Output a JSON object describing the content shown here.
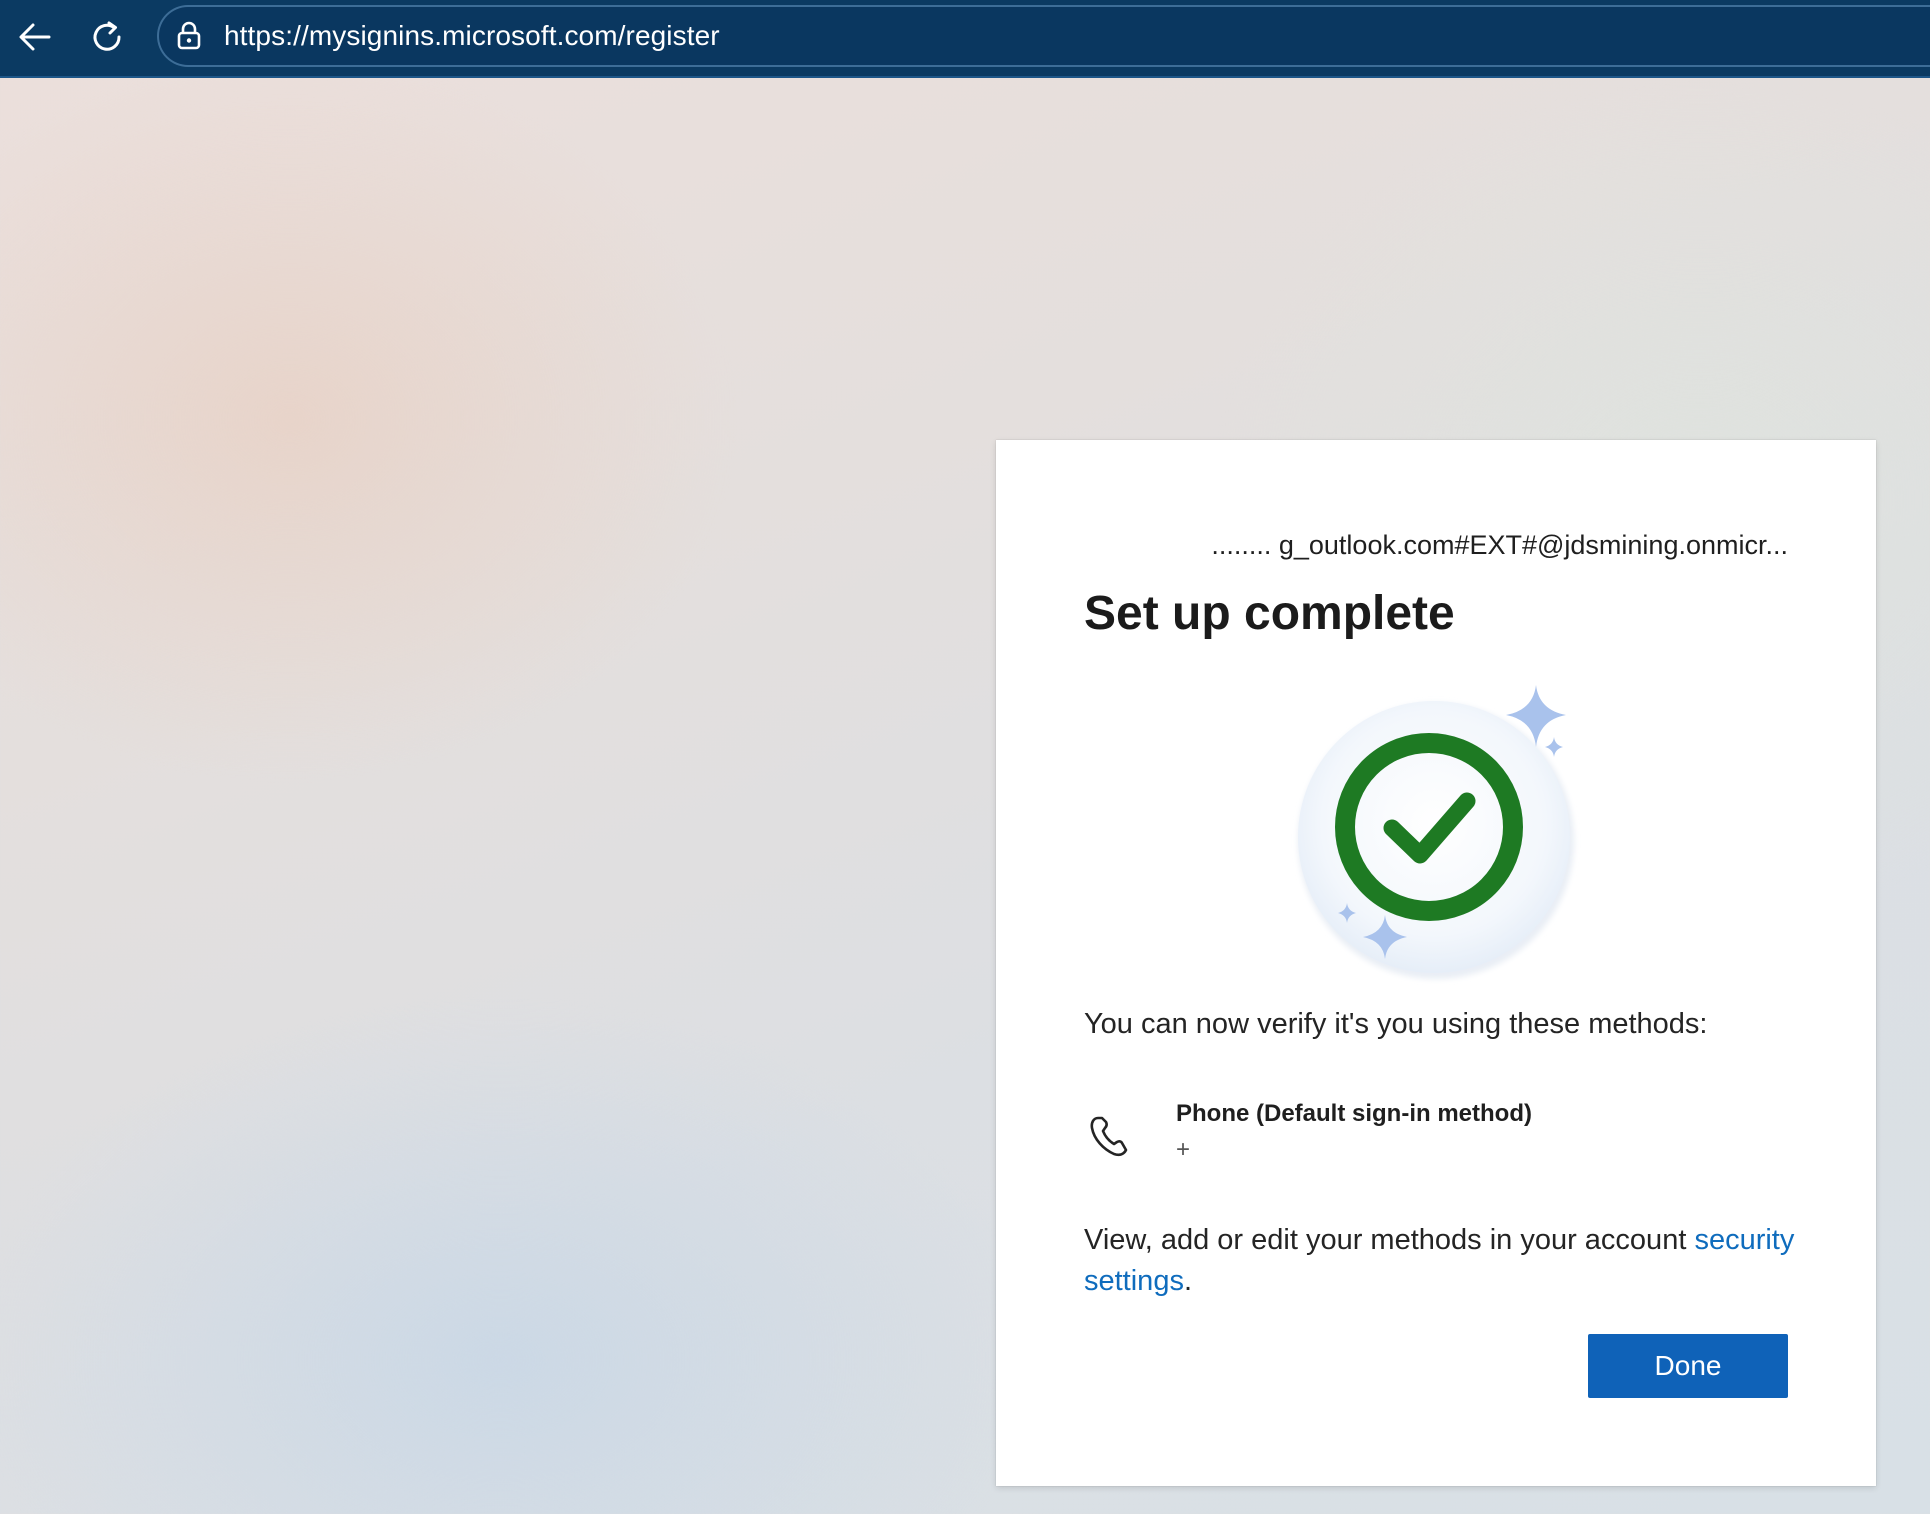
{
  "browser": {
    "url": "https://mysignins.microsoft.com/register",
    "icons": {
      "back": "back-arrow-icon",
      "reload": "reload-icon",
      "lock": "lock-icon"
    }
  },
  "card": {
    "identity": "........ g_outlook.com#EXT#@jdsmining.onmicr...",
    "title": "Set up complete",
    "illustration": "success-checkmark-icon",
    "methods_intro": "You can now verify it's you using these methods:",
    "methods": [
      {
        "icon": "phone-icon",
        "name": "Phone (Default sign-in method)",
        "detail": "+"
      }
    ],
    "footer_text": "View, add or edit your methods in your account",
    "footer_link": "security settings",
    "footer_period": ".",
    "done_label": "Done"
  },
  "colors": {
    "browser_bar": "#0b3a62",
    "accent_blue": "#0f62b8",
    "link_blue": "#0f6cbd",
    "success_green": "#1e7a23",
    "sparkle_blue": "#a9c2ec"
  }
}
